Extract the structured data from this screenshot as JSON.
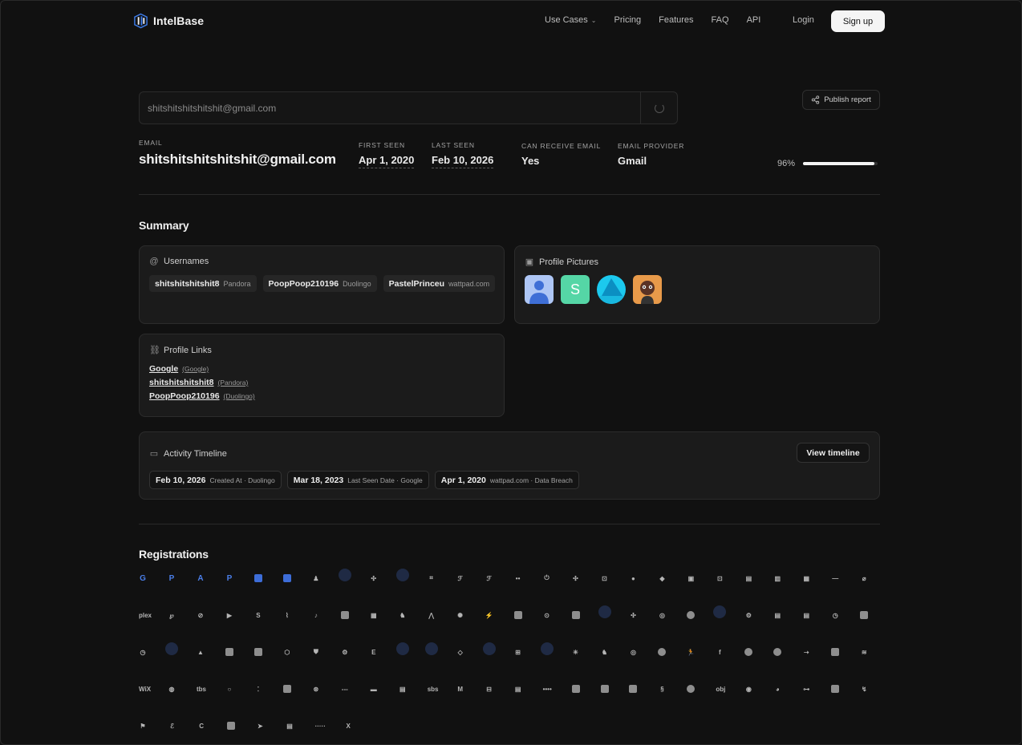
{
  "nav": {
    "brand": "IntelBase",
    "links": [
      "Use Cases",
      "Pricing",
      "Features",
      "FAQ",
      "API"
    ],
    "login": "Login",
    "signup": "Sign up"
  },
  "search": {
    "value": "shitshitshitshitshit@gmail.com",
    "publish_label": "Publish report"
  },
  "email": {
    "label": "EMAIL",
    "value": "shitshitshitshitshit@gmail.com",
    "first_seen_label": "FIRST SEEN",
    "first_seen": "Apr 1, 2020",
    "last_seen_label": "LAST SEEN",
    "last_seen": "Feb 10, 2026",
    "can_receive_label": "CAN RECEIVE EMAIL",
    "can_receive": "Yes",
    "provider_label": "EMAIL PROVIDER",
    "provider": "Gmail",
    "score_text": "96%",
    "score": 0.96
  },
  "summary": {
    "title": "Summary",
    "usernames_title": "Usernames",
    "usernames": [
      {
        "name": "shitshitshitshit8",
        "source": "Pandora"
      },
      {
        "name": "PoopPoop210196",
        "source": "Duolingo"
      },
      {
        "name": "PastelPrinceu",
        "source": "wattpad.com"
      }
    ],
    "pictures_title": "Profile Pictures",
    "links_title": "Profile Links",
    "links": [
      {
        "name": "Google",
        "source": "(Google)"
      },
      {
        "name": "shitshitshitshit8",
        "source": "(Pandora)"
      },
      {
        "name": "PoopPoop210196",
        "source": "(Duolingo)"
      }
    ]
  },
  "timeline": {
    "title": "Activity Timeline",
    "view_label": "View timeline",
    "items": [
      {
        "date": "Feb 10, 2026",
        "detail": "Created At · Duolingo"
      },
      {
        "date": "Mar 18, 2023",
        "detail": "Last Seen Date · Google"
      },
      {
        "date": "Apr 1, 2020",
        "detail": "wattpad.com · Data Breach"
      }
    ]
  },
  "registrations": {
    "title": "Registrations",
    "icons": [
      [
        "google-icon",
        "paypal-icon",
        "atlassian-icon",
        "pinterest-icon",
        "square-icon",
        "office-icon",
        "chess-icon",
        "dot-icon",
        "dropbox-icon",
        "dot-icon",
        "slack-icon",
        "flag-icon",
        "flag2-icon",
        "dots-icon",
        "power-icon",
        "dropbox-icon",
        "pocket-icon",
        "github-icon",
        "gitlab-icon",
        "circle-icon",
        "app-icon",
        "doc-icon",
        "chart-icon",
        "trello-icon",
        "dash-icon",
        "strava-icon"
      ],
      [
        "plex-icon",
        "pinterest-icon",
        "link-icon",
        "play-icon",
        "skype-icon",
        "activity-icon",
        "tiktok-icon",
        "apple-icon",
        "reader-icon",
        "snap-icon",
        "arrow-icon",
        "circle-icon",
        "bolt-icon",
        "square-icon",
        "user-icon",
        "square-icon",
        "dot-icon",
        "dropbox-icon",
        "instagram-icon",
        "circle-icon",
        "dot-icon",
        "gear-icon",
        "doc-icon",
        "doc-icon",
        "clock-icon",
        "square-icon"
      ],
      [
        "clock-icon",
        "dot-icon",
        "triangle-icon",
        "square-icon",
        "square-icon",
        "gear-icon",
        "shield-icon",
        "gear-icon",
        "etsy-icon",
        "dot-icon",
        "dot-icon",
        "code-icon",
        "dot-icon",
        "windows-icon",
        "dot-icon",
        "asterisk-icon",
        "snap-icon",
        "instagram-icon",
        "circle-icon",
        "run-icon",
        "facebook-icon",
        "circle-icon",
        "circle-icon",
        "arrow-icon",
        "square-icon",
        "rss-icon"
      ],
      [
        "wix-icon",
        "globe-icon",
        "text-icon",
        "search-icon",
        "dash-icon",
        "square-icon",
        "globe-icon",
        "dash-icon",
        "trash-icon",
        "doc-icon",
        "text-icon",
        "books-icon",
        "box-icon",
        "doc-icon",
        "dash-icon",
        "square-icon",
        "square-icon",
        "square-icon",
        "s-icon",
        "circle-icon",
        "text-icon",
        "spotify-icon",
        "gear-icon",
        "flow-icon",
        "square-icon",
        "hub-icon"
      ],
      [
        "flag-icon",
        "text-icon",
        "c-icon",
        "square-icon",
        "bird-icon",
        "doc-icon",
        "dash-icon",
        "x-icon"
      ]
    ],
    "glyphs": [
      [
        "G",
        "P",
        "A",
        "P",
        "",
        "□",
        "♟",
        "",
        "✣",
        "",
        "⌗",
        "ℱ",
        "ℱ",
        "••",
        "⏻",
        "✣",
        "⊡",
        "●",
        "◆",
        "▣",
        "⊡",
        "▤",
        "▥",
        "▦",
        "—",
        "⌀"
      ],
      [
        "plex",
        "℘",
        "⊘",
        "▶",
        "S",
        "⌇",
        "♪",
        "",
        "▦",
        "♞",
        "⋀",
        "✺",
        "⚡",
        "",
        "⊙",
        "",
        "",
        "✣",
        "◎",
        "",
        "",
        "⚙",
        "▤",
        "▤",
        "◷",
        ""
      ],
      [
        "◷",
        "",
        "▲",
        "",
        "",
        "⬡",
        "⛊",
        "⚙",
        "E",
        "",
        "",
        "◇",
        "",
        "⊞",
        "",
        "✳",
        "♞",
        "◎",
        "",
        "🏃",
        "f",
        "",
        "",
        "➝",
        "",
        "≋"
      ],
      [
        "WiX",
        "◍",
        "tbs",
        "○",
        "⁚",
        "",
        "⊛",
        "---",
        "▬",
        "▤",
        "sbs",
        "M",
        "⊟",
        "▤",
        "••••",
        "",
        "",
        "",
        "§",
        "",
        "obj",
        "◉",
        "◕",
        "⊶",
        "",
        "↯"
      ],
      [
        "⚑",
        "ℰ",
        "C",
        "",
        "➤",
        "▤",
        "·····",
        "X"
      ]
    ]
  }
}
